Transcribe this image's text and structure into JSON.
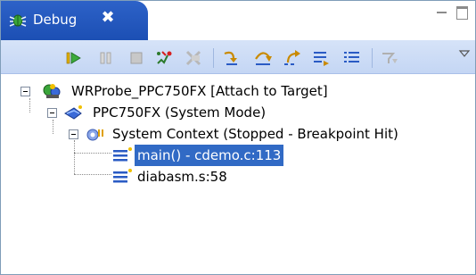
{
  "tab": {
    "title": "Debug",
    "close_glyph": "✖"
  },
  "toolbar": {
    "buttons": [
      {
        "name": "resume-icon",
        "enabled": true
      },
      {
        "name": "suspend-icon",
        "enabled": false
      },
      {
        "name": "terminate-icon",
        "enabled": false
      },
      {
        "name": "disconnect-icon",
        "enabled": true
      },
      {
        "name": "remove-terminated-icon",
        "enabled": false
      },
      {
        "name": "step-into-icon",
        "enabled": true
      },
      {
        "name": "step-over-icon",
        "enabled": true
      },
      {
        "name": "step-return-icon",
        "enabled": true
      },
      {
        "name": "drop-to-frame-icon",
        "enabled": true
      },
      {
        "name": "instruction-stepping-icon",
        "enabled": true
      },
      {
        "name": "use-step-filters-icon",
        "enabled": false
      }
    ]
  },
  "tree": {
    "target": "WRProbe_PPC750FX [Attach to Target]",
    "process": "PPC750FX (System Mode)",
    "thread": "System Context (Stopped - Breakpoint Hit)",
    "frames": [
      "main() - cdemo.c:113",
      "diabasm.s:58"
    ]
  },
  "colors": {
    "tab_blue": "#1c4fb4",
    "selection": "#316ac5",
    "toolbar": "#c8d8f4"
  }
}
